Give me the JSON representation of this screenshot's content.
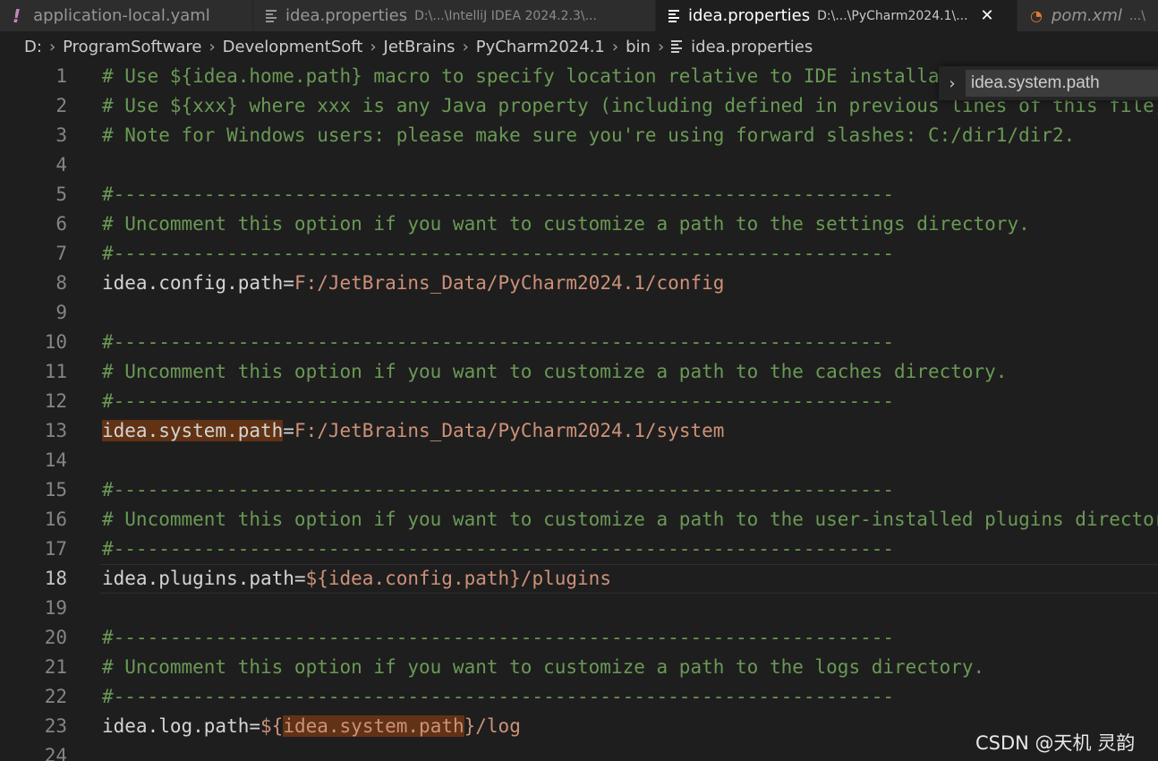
{
  "tabs": [
    {
      "icon": "yaml-icon",
      "label": "application-local.yaml",
      "desc": "",
      "active": false
    },
    {
      "icon": "properties-icon",
      "label": "idea.properties",
      "desc": "D:\\...\\IntelliJ IDEA 2024.2.3\\...",
      "active": false
    },
    {
      "icon": "properties-icon",
      "label": "idea.properties",
      "desc": "D:\\...\\PyCharm2024.1\\...",
      "active": true,
      "close": "✕"
    },
    {
      "icon": "rss-icon",
      "label": "pom.xml",
      "desc": "...\\",
      "active": false
    }
  ],
  "breadcrumb": [
    "D:",
    "ProgramSoftware",
    "DevelopmentSoft",
    "JetBrains",
    "PyCharm2024.1",
    "bin",
    "idea.properties"
  ],
  "find": {
    "value": "idea.system.path",
    "chevron": "›"
  },
  "current_line": 18,
  "lines": [
    {
      "n": "1",
      "t": [
        {
          "c": "c-comment",
          "s": "# Use ${idea.home.path} macro to specify location relative to IDE installation home."
        }
      ]
    },
    {
      "n": "2",
      "t": [
        {
          "c": "c-comment",
          "s": "# Use ${xxx} where xxx is any Java property (including defined in previous lines of this file)"
        }
      ]
    },
    {
      "n": "3",
      "t": [
        {
          "c": "c-comment",
          "s": "# Note for Windows users: please make sure you're using forward slashes: C:/dir1/dir2."
        }
      ]
    },
    {
      "n": "4",
      "t": []
    },
    {
      "n": "5",
      "t": [
        {
          "c": "c-comment",
          "s": "#---------------------------------------------------------------------"
        }
      ]
    },
    {
      "n": "6",
      "t": [
        {
          "c": "c-comment",
          "s": "# Uncomment this option if you want to customize a path to the settings directory."
        }
      ]
    },
    {
      "n": "7",
      "t": [
        {
          "c": "c-comment",
          "s": "#---------------------------------------------------------------------"
        }
      ]
    },
    {
      "n": "8",
      "t": [
        {
          "c": "c-key",
          "s": "idea.config.path"
        },
        {
          "c": "c-op",
          "s": "="
        },
        {
          "c": "c-val",
          "s": "F:/JetBrains_Data/PyCharm2024.1/config"
        }
      ]
    },
    {
      "n": "9",
      "t": []
    },
    {
      "n": "10",
      "t": [
        {
          "c": "c-comment",
          "s": "#---------------------------------------------------------------------"
        }
      ]
    },
    {
      "n": "11",
      "t": [
        {
          "c": "c-comment",
          "s": "# Uncomment this option if you want to customize a path to the caches directory."
        }
      ]
    },
    {
      "n": "12",
      "t": [
        {
          "c": "c-comment",
          "s": "#---------------------------------------------------------------------"
        }
      ]
    },
    {
      "n": "13",
      "t": [
        {
          "c": "c-key hl",
          "s": "idea.system.path"
        },
        {
          "c": "c-op",
          "s": "="
        },
        {
          "c": "c-val",
          "s": "F:/JetBrains_Data/PyCharm2024.1/system"
        }
      ]
    },
    {
      "n": "14",
      "t": []
    },
    {
      "n": "15",
      "t": [
        {
          "c": "c-comment",
          "s": "#---------------------------------------------------------------------"
        }
      ]
    },
    {
      "n": "16",
      "t": [
        {
          "c": "c-comment",
          "s": "# Uncomment this option if you want to customize a path to the user-installed plugins directory."
        }
      ]
    },
    {
      "n": "17",
      "t": [
        {
          "c": "c-comment",
          "s": "#---------------------------------------------------------------------"
        }
      ]
    },
    {
      "n": "18",
      "t": [
        {
          "c": "c-key",
          "s": "idea.plugins.path"
        },
        {
          "c": "c-op",
          "s": "="
        },
        {
          "c": "c-val",
          "s": "${idea.config.path}/plugins"
        }
      ]
    },
    {
      "n": "19",
      "t": []
    },
    {
      "n": "20",
      "t": [
        {
          "c": "c-comment",
          "s": "#---------------------------------------------------------------------"
        }
      ]
    },
    {
      "n": "21",
      "t": [
        {
          "c": "c-comment",
          "s": "# Uncomment this option if you want to customize a path to the logs directory."
        }
      ]
    },
    {
      "n": "22",
      "t": [
        {
          "c": "c-comment",
          "s": "#---------------------------------------------------------------------"
        }
      ]
    },
    {
      "n": "23",
      "t": [
        {
          "c": "c-key",
          "s": "idea.log.path"
        },
        {
          "c": "c-op",
          "s": "="
        },
        {
          "c": "c-val",
          "s": "${"
        },
        {
          "c": "c-val hl",
          "s": "idea.system.path"
        },
        {
          "c": "c-val",
          "s": "}/log"
        }
      ]
    },
    {
      "n": "24",
      "t": []
    }
  ],
  "watermark": "CSDN @天机 灵韵"
}
